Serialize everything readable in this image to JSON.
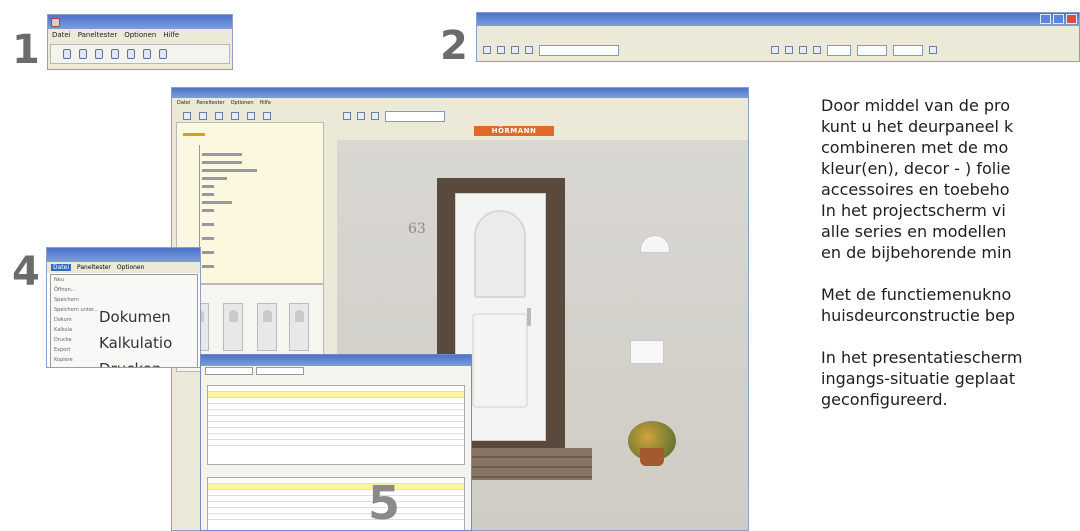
{
  "labels": {
    "n1": "1",
    "n2": "2",
    "n4": "4",
    "n5": "5"
  },
  "screen1": {
    "title": "",
    "menu": [
      "Datei",
      "Paneltester",
      "Optionen",
      "Hilfe"
    ]
  },
  "screen2": {
    "combo": "",
    "combo2": ""
  },
  "main": {
    "menu": [
      "Datei",
      "Paneltester",
      "Optionen",
      "Hilfe"
    ],
    "brand": "HÖRMANN",
    "house_number": "63"
  },
  "screen4": {
    "menu": [
      "Datei",
      "Paneltester",
      "Optionen"
    ],
    "small_items": [
      "Neu",
      "Öffnen...",
      "Speichern",
      "Speichern unter..."
    ],
    "left_items": [
      "Dokum",
      "Kalkula",
      "Drucke",
      "Export",
      "Kopiere"
    ],
    "big_items": [
      "Dokumen",
      "Kalkulatio",
      "Drucken..."
    ]
  },
  "text": {
    "p1": [
      "Door middel van de pro",
      "kunt u het deurpaneel k",
      "combineren met de mo",
      "kleur(en), decor - ) folie",
      "accessoires en toebeho",
      "In het projectscherm vi",
      "alle series en modellen",
      "en de bijbehorende min"
    ],
    "p2": [
      "Met de functiemenukno",
      "huisdeurconstructie bep"
    ],
    "p3": [
      "In het presentatiescherm",
      "ingangs-situatie geplaat",
      "geconfigureerd."
    ]
  }
}
